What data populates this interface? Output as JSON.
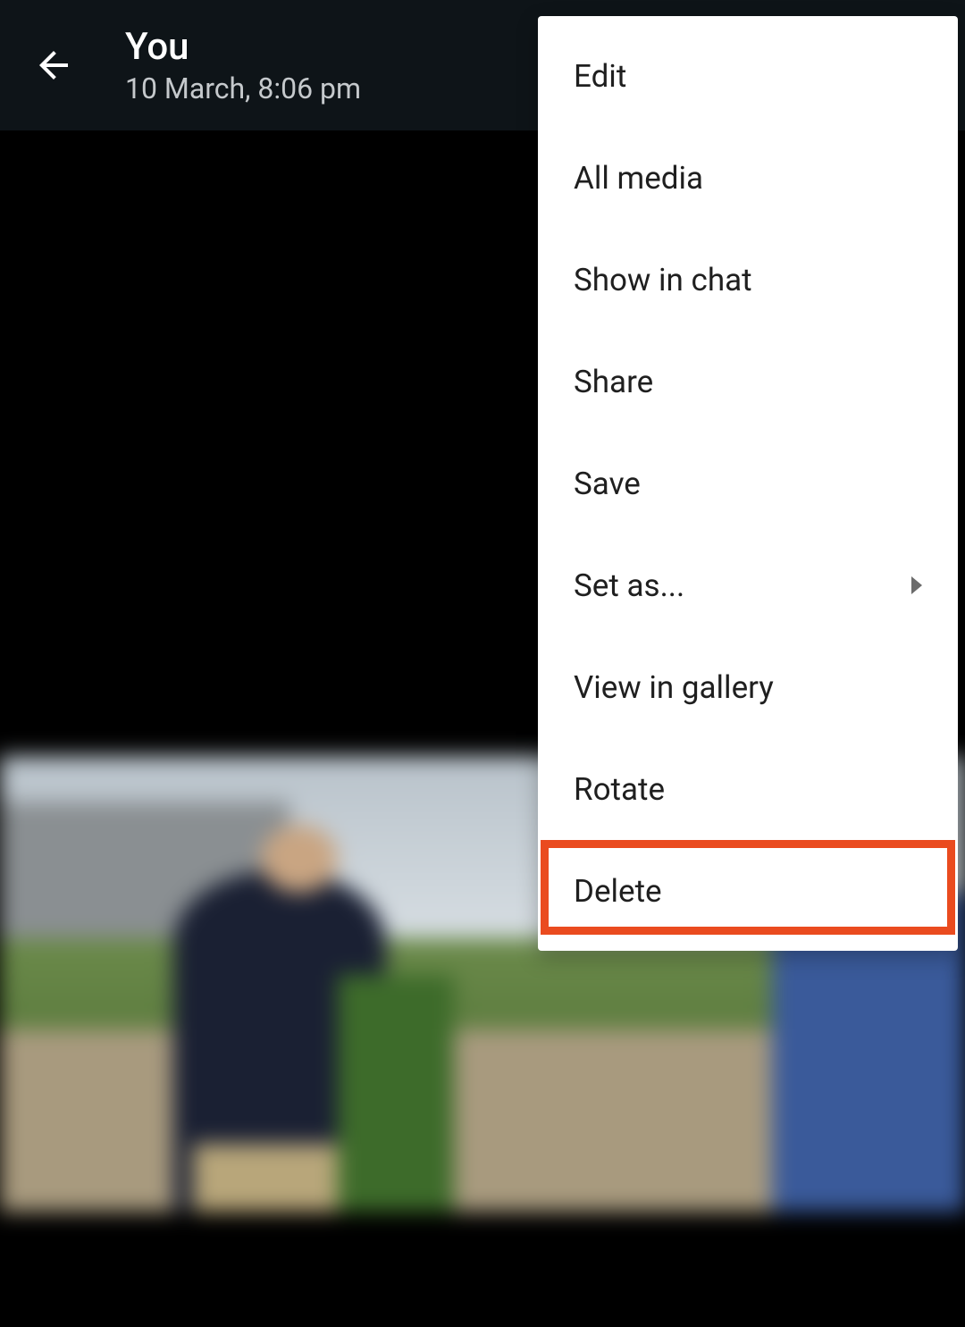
{
  "header": {
    "title": "You",
    "subtitle": "10 March, 8:06 pm"
  },
  "menu": {
    "items": [
      {
        "label": "Edit",
        "submenu": false
      },
      {
        "label": "All media",
        "submenu": false
      },
      {
        "label": "Show in chat",
        "submenu": false
      },
      {
        "label": "Share",
        "submenu": false
      },
      {
        "label": "Save",
        "submenu": false
      },
      {
        "label": "Set as...",
        "submenu": true
      },
      {
        "label": "View in gallery",
        "submenu": false
      },
      {
        "label": "Rotate",
        "submenu": false
      },
      {
        "label": "Delete",
        "submenu": false
      }
    ]
  },
  "highlight": {
    "color": "#ea4b1f"
  }
}
